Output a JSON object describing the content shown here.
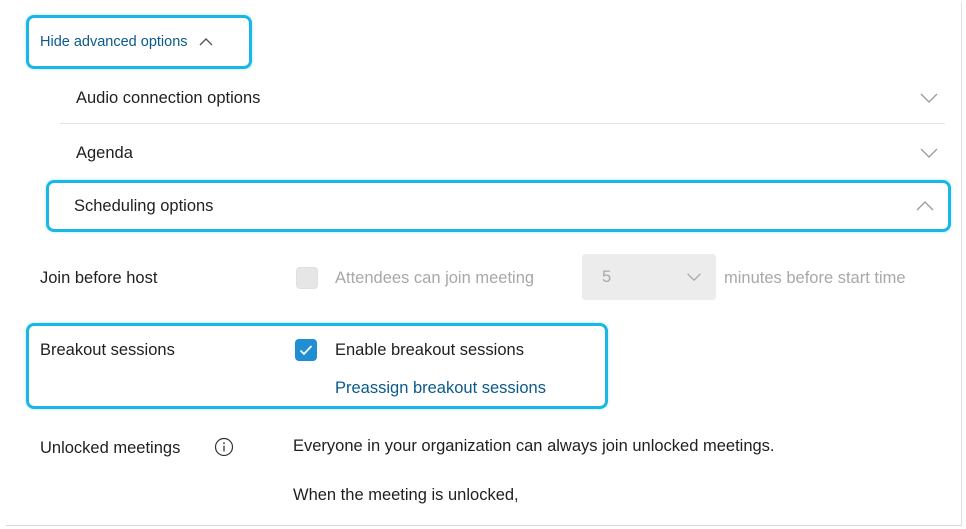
{
  "advanced_toggle": {
    "label": "Hide advanced options"
  },
  "sections": [
    {
      "label": "Audio connection options",
      "expanded": false
    },
    {
      "label": "Agenda",
      "expanded": false
    },
    {
      "label": "Scheduling options",
      "expanded": true
    }
  ],
  "join_before_host": {
    "label": "Join before host",
    "checked": false,
    "text_before": "Attendees can join meeting",
    "minutes_value": "5",
    "text_after": "minutes before start time"
  },
  "breakout": {
    "label": "Breakout sessions",
    "checked": true,
    "checkbox_label": "Enable breakout sessions",
    "preassign_link": "Preassign breakout sessions"
  },
  "unlocked": {
    "label": "Unlocked meetings",
    "line1": "Everyone in your organization can always join unlocked meetings.",
    "line2": "When the meeting is unlocked,"
  },
  "colors": {
    "highlight": "#1ab7e6",
    "link": "#0a5a8c",
    "checkbox": "#1f8fd1"
  }
}
